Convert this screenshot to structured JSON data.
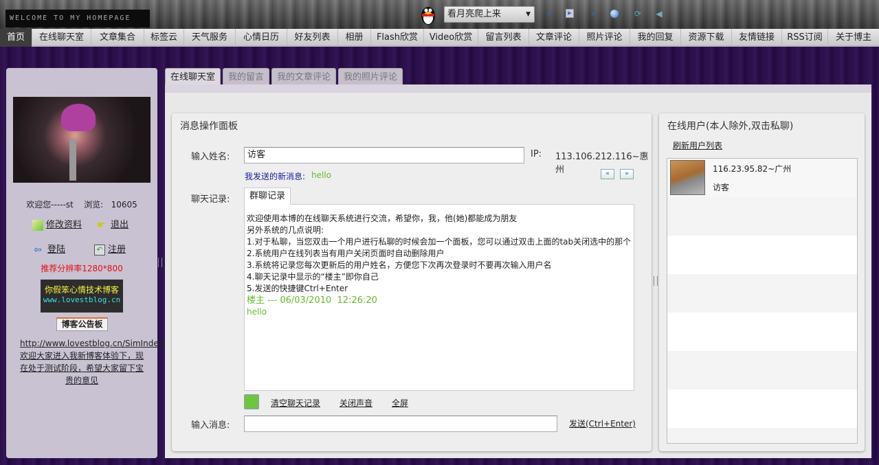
{
  "header": {
    "marquee": "WELCOME TO MY HOMEPAGE",
    "player": {
      "song": "看月亮爬上来",
      "buttons": [
        "previous-icon",
        "play-icon",
        "next-icon",
        "stop-icon",
        "loop-icon",
        "volume-icon"
      ]
    }
  },
  "nav": {
    "items": [
      "首页",
      "在线聊天室",
      "文章集合",
      "标签云",
      "天气服务",
      "心情日历",
      "好友列表",
      "相册",
      "Flash欣赏",
      "Video欣赏",
      "留言列表",
      "文章评论",
      "照片评论",
      "我的回复",
      "资源下载",
      "友情链接",
      "RSS订阅",
      "关于博主"
    ],
    "active": 0
  },
  "sidebar": {
    "welcome": "欢迎您-----st",
    "views_label": "浏览:",
    "views": "10605",
    "edit_profile": "修改资料",
    "logout": "退出",
    "login": "登陆",
    "register": "注册",
    "resolution": "推荐分辨率1280*800",
    "banner_title": "你假笨心情技术博客",
    "banner_url": "www.lovestblog.cn",
    "board_title": "博客公告板",
    "notice": "http://www.lovestblog.cn/SimIndex.html欢迎大家进入我新博客体验下，现在处于测试阶段，希望大家留下宝贵的意见"
  },
  "tabs": [
    "在线聊天室",
    "我的留言",
    "我的文章评论",
    "我的照片评论"
  ],
  "chat": {
    "panel_title": "消息操作面板",
    "name_label": "输入姓名:",
    "name_value": "访客",
    "ip_label": "IP:",
    "ip_value": "113.106.212.116~惠州",
    "sent_label": "我发送的新消息:",
    "sent_value": "hello",
    "history_label": "聊天记录:",
    "history_tab": "群聊记录",
    "messages": [
      "欢迎使用本博的在线聊天系统进行交流，希望你，我，他(她)都能成为朋友",
      "另外系统的几点说明:",
      "1.对于私聊，当您双击一个用户进行私聊的时候会加一个面板，您可以通过双击上面的tab关闭选中的那个",
      "2.系统用户在线列表当有用户关闭页面时自动删除用户",
      "3.系统将记录您每次更新后的用户姓名，方便您下次再次登录时不要再次输入用户名",
      "4.聊天记录中显示的“楼主”即你自己",
      "5.发送的快捷键Ctrl+Enter"
    ],
    "last_sender": "楼主 --- 06/03/2010  12:26:20",
    "last_message": "hello",
    "clear": "清空聊天记录",
    "mute": "关闭声音",
    "fullscreen": "全屏",
    "input_label": "输入消息:",
    "input_value": "",
    "send": "发送(Ctrl+Enter)"
  },
  "online": {
    "title": "在线用户(本人除外,双击私聊)",
    "refresh": "刷新用户列表",
    "users": [
      {
        "ip": "116.23.95.82~广州",
        "name": "访客"
      }
    ]
  },
  "colors": {
    "accent_green": "#66b830",
    "purple_bg": "#2a1048",
    "red": "#e01010"
  }
}
